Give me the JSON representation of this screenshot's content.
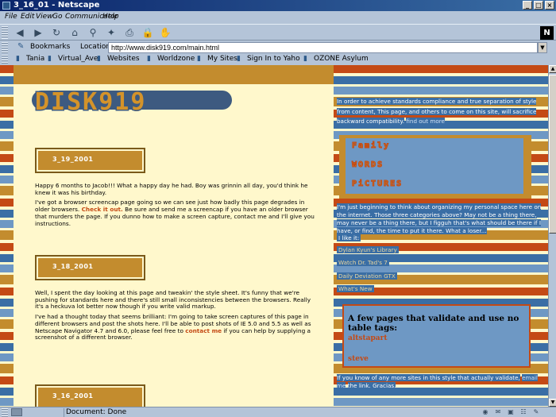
{
  "window": {
    "title": "3_16_01 - Netscape"
  },
  "menu": [
    {
      "label": "File"
    },
    {
      "label": "Edit"
    },
    {
      "label": "View"
    },
    {
      "label": "Go"
    },
    {
      "label": "Communicator"
    },
    {
      "label": "Help"
    }
  ],
  "toolbar_icons": [
    {
      "name": "back-icon",
      "glyph": "◀"
    },
    {
      "name": "forward-icon",
      "glyph": "▶"
    },
    {
      "name": "reload-icon",
      "glyph": "↻"
    },
    {
      "name": "home-icon",
      "glyph": "⌂"
    },
    {
      "name": "search-icon",
      "glyph": "⚲"
    },
    {
      "name": "my-netscape-icon",
      "glyph": "✦"
    },
    {
      "name": "print-icon",
      "glyph": "⎙"
    },
    {
      "name": "security-icon",
      "glyph": "🔒"
    },
    {
      "name": "stop-icon",
      "glyph": "✋"
    }
  ],
  "location": {
    "bookmarks_label": "Bookmarks",
    "location_label": "Location:",
    "url": "http://www.disk919.com/main.html"
  },
  "personal_toolbar": [
    {
      "label": "Tania"
    },
    {
      "label": "Virtual_Ave"
    },
    {
      "label": "Websites"
    },
    {
      "label": "Worldzone"
    },
    {
      "label": "My Sites"
    },
    {
      "label": "Sign In to Yaho"
    },
    {
      "label": "OZONE Asylum"
    }
  ],
  "page": {
    "logo": "DISK919",
    "entries": [
      {
        "date": "3_19_2001",
        "p1": "Happy 6 months to Jacob!!! What a happy day he had. Boy was grinnin all day, you'd think he knew it was his birthday.",
        "p2a": "I've got a browser screencap page going so we can see just how badly this page degrades in older browsers.",
        "p2link": "Check it out.",
        "p2b": "Be sure and send me a screencap if you have an older browser that murders the page. If you dunno how to make a screen capture, contact me and I'll give you instructions."
      },
      {
        "date": "3_18_2001",
        "p1": "Well, I spent the day looking at this page and tweakin' the style sheet. It's funny that we're pushing for standards here and there's still small inconsistencies between the browsers. Really it's a heckuva lot better now though if you write valid markup.",
        "p2a": "I've had a thought today that seems brilliant: I'm going to take screen captures of this page in different browsers and post the shots here. I'll be able to post shots of IE 5.0 and 5.5 as well as Netscape Navigator 4.7 and 6.0, please feel free to",
        "p2link": "contact me",
        "p2b": "if you can help by supplying a screenshot of a different browser."
      },
      {
        "date": "3_16_2001"
      }
    ],
    "sidebar": {
      "intro1": "In order to achieve standards compliance and true separation of style",
      "intro2a": "from content, This page, and others to come on this site, will sacrifice backward compatibility.",
      "intro2link": "find out more",
      "nav": [
        "Family",
        "WORDS",
        "PiCTURES"
      ],
      "organize": "I'm just beginning to think about organizing my personal space here on the internet. Those three categories above? May not be a thing there, may never be a thing there, but I figguh that's what should be there if I have, or find, the time to put it there. What a loser...",
      "i_like": "I like it:",
      "links": [
        "Dylan Kyun's Library",
        "Watch Dr. Tad's 7",
        "Daily Deviation GTX",
        "What's New"
      ],
      "validate_title": "A few pages that validate and use no table tags:",
      "validate_links": [
        "altstapart",
        "steve"
      ],
      "footer_a": "If you know of any more sites in this style that actually validate,",
      "footer_link": "email me",
      "footer_b": "the link. Gracias."
    }
  },
  "status": {
    "text": "Document: Done"
  },
  "colors": {
    "orange": "#c38c2e",
    "rust": "#c44a15",
    "blue": "#3a6ea5",
    "lightblue": "#6e98c4",
    "cream": "#fff8cc"
  }
}
